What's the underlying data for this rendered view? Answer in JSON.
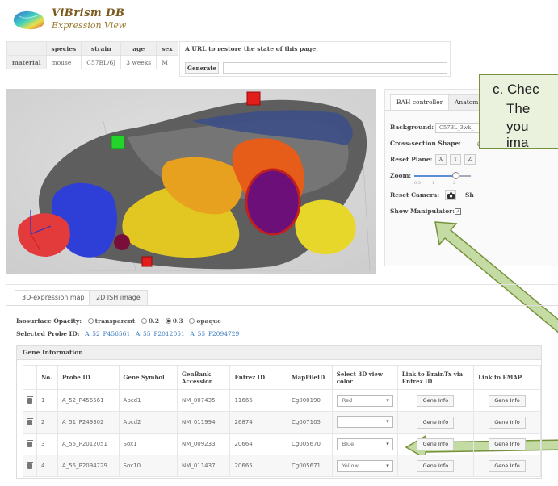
{
  "header": {
    "app_title": "ViBrism DB",
    "app_subtitle": "Expression View"
  },
  "material_table": {
    "row_label": "material",
    "headers": [
      "species",
      "strain",
      "age",
      "sex"
    ],
    "values": [
      "mouse",
      "C57BL/6J",
      "3 weeks",
      "M"
    ]
  },
  "url_restore": {
    "label": "A URL to restore the state of this page:",
    "generate_label": "Generate",
    "value": ""
  },
  "controller": {
    "tabs": [
      "BAH controller",
      "Anatom"
    ],
    "background_label": "Background:",
    "background_value": "C57BL_3wk_",
    "cross_section_label": "Cross-section Shape:",
    "cross_section_value": "P",
    "reset_plane_label": "Reset Plane:",
    "reset_plane_buttons": [
      "X",
      "Y",
      "Z"
    ],
    "zoom_label": "Zoom:",
    "zoom_ticks": [
      "0.5",
      "1",
      "2"
    ],
    "reset_camera_label": "Reset Camera:",
    "reset_camera_extra": "Sh",
    "show_manipulator_label": "Show Manipulator:"
  },
  "callout": {
    "line1": "c. Chec",
    "line2": "The",
    "line3": "you",
    "line4": "ima"
  },
  "bottom_tabs": [
    "3D-expression map",
    "2D ISH image"
  ],
  "opacity": {
    "label": "Isosurface Opacity:",
    "options": [
      "transparent",
      "0.2",
      "0.3",
      "opaque"
    ],
    "selected": "0.3"
  },
  "selected_probes": {
    "label": "Selected Probe ID:",
    "ids": [
      "A_52_P456561",
      "A_55_P2012051",
      "A_55_P2094729"
    ]
  },
  "gene_info": {
    "title": "Gene Information",
    "columns": [
      "",
      "No.",
      "Probe ID",
      "Gene Symbol",
      "GenBank Accession",
      "Entrez ID",
      "MapFileID",
      "Select 3D view color",
      "Link to BrainTx via Entrez ID",
      "Link to EMAP"
    ],
    "rows": [
      {
        "no": "1",
        "probe": "A_52_P456561",
        "symbol": "Abcd1",
        "genbank": "NM_007435",
        "entrez": "11666",
        "mapfile": "Cg000190",
        "color": "Red",
        "btx": "Gene Info",
        "emap": "Gene Info"
      },
      {
        "no": "2",
        "probe": "A_51_P249302",
        "symbol": "Abcd2",
        "genbank": "NM_011994",
        "entrez": "26874",
        "mapfile": "Cg007105",
        "color": "",
        "btx": "Gene Info",
        "emap": "Gene Info"
      },
      {
        "no": "3",
        "probe": "A_55_P2012051",
        "symbol": "Sox1",
        "genbank": "NM_009233",
        "entrez": "20664",
        "mapfile": "Cg005670",
        "color": "Blue",
        "btx": "Gene Info",
        "emap": "Gene Info"
      },
      {
        "no": "4",
        "probe": "A_55_P2094729",
        "symbol": "Sox10",
        "genbank": "NM_011437",
        "entrez": "20665",
        "mapfile": "Cg005671",
        "color": "Yellow",
        "btx": "Gene Info",
        "emap": "Gene Info"
      }
    ]
  },
  "colors": {
    "callout_fill": "#eaf1dd",
    "callout_border": "#76923c",
    "arrow_fill": "#c4dca4",
    "link": "#3a7bbf"
  }
}
